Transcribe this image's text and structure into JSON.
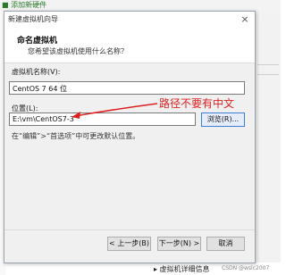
{
  "background": {
    "top_item": "■ 添加新硬件",
    "bottom_item": "▸ 虚拟机详细信息",
    "watermark": "CSDN @wslc2007"
  },
  "dialog": {
    "title": "新建虚拟机向导",
    "close_glyph": "×",
    "header_title": "命名虚拟机",
    "header_subtitle": "您希望该虚拟机使用什么名称？",
    "vm_name_label": "虚拟机名称(V):",
    "vm_name_value": "CentOS 7 64 位",
    "location_label": "位置(L):",
    "location_value": "E:\\vm\\CentOS7-3",
    "browse_label": "浏览(R)...",
    "hint": "在“编辑”>“首选项”中可更改默认位置。",
    "back_label": "< 上一步(B)",
    "next_label": "下一步(N) >",
    "cancel_label": "取消"
  },
  "annotation": {
    "text": "路径不要有中文",
    "color": "#e02020"
  }
}
